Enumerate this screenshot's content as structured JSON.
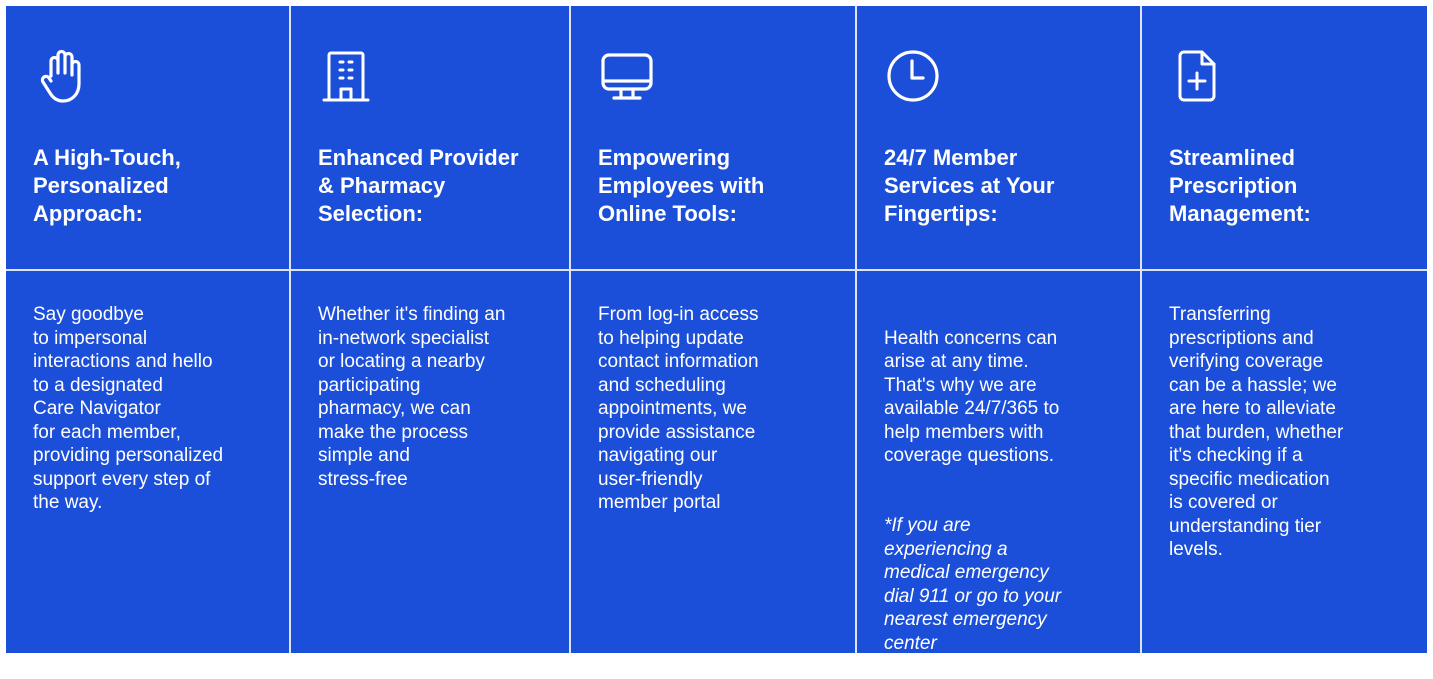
{
  "cards": [
    {
      "icon": "raised-hand-icon",
      "title": "A High-Touch,\nPersonalized\nApproach:",
      "body": "Say goodbye\nto impersonal\ninteractions and hello\nto a designated\nCare Navigator\nfor each member,\nproviding personalized\nsupport every step of\nthe way."
    },
    {
      "icon": "building-icon",
      "title": "Enhanced Provider\n&  Pharmacy\nSelection:",
      "body": "Whether it's finding an\nin-network specialist\nor locating a nearby\nparticipating\npharmacy, we can\nmake the process\nsimple and\nstress-free"
    },
    {
      "icon": "monitor-icon",
      "title": "Empowering\nEmployees with\nOnline Tools:",
      "body": "From log-in access\nto helping update\ncontact information\nand scheduling\nappointments, we\nprovide assistance\nnavigating our\nuser-friendly\nmember portal"
    },
    {
      "icon": "clock-icon",
      "title": "24/7 Member\nServices at Your\nFingertips:",
      "body": "Health concerns can\narise at any time.\nThat's why we are\navailable 24/7/365 to\nhelp members with\ncoverage questions.",
      "note": "*If you are\nexperiencing a\nmedical emergency\ndial 911 or go to your\nnearest emergency\ncenter"
    },
    {
      "icon": "document-plus-icon",
      "title": "Streamlined\nPrescription\nManagement:",
      "body": "Transferring\nprescriptions and\nverifying coverage\ncan be a hassle; we\nare here to alleviate\nthat burden, whether\nit's checking if a\nspecific medication\nis covered or\nunderstanding tier\nlevels."
    }
  ],
  "colors": {
    "background": "#1c4fd9",
    "text": "#ffffff",
    "divider": "#ffffff"
  }
}
